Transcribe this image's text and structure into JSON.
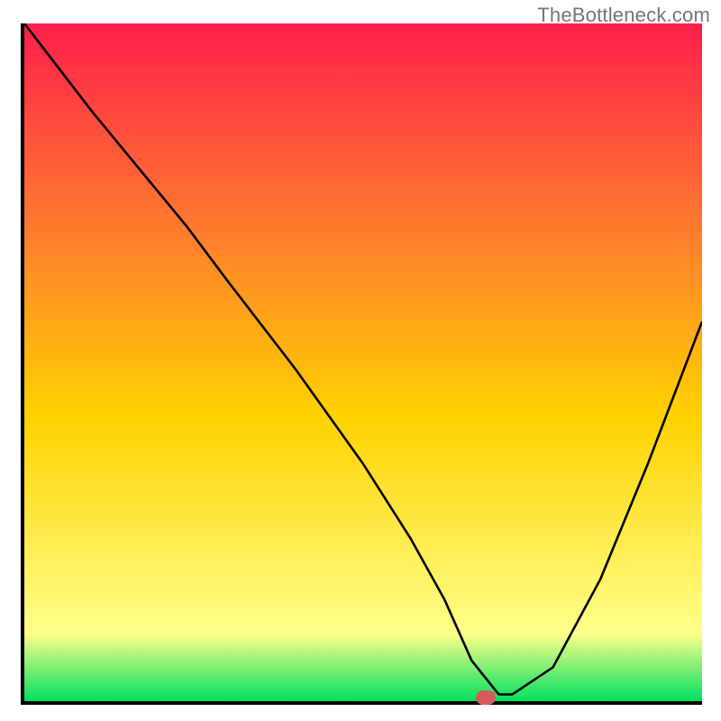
{
  "attribution": "TheBottleneck.com",
  "chart_data": {
    "type": "line",
    "title": "",
    "xlabel": "",
    "ylabel": "",
    "xlim": [
      0,
      100
    ],
    "ylim": [
      0,
      100
    ],
    "series": [
      {
        "name": "curve",
        "x": [
          0,
          10,
          24,
          30,
          40,
          50,
          57,
          62,
          66,
          70,
          72,
          78,
          85,
          92,
          100
        ],
        "values": [
          100,
          87,
          70,
          62,
          49,
          35,
          24,
          15,
          6,
          1,
          1,
          5,
          18,
          35,
          56
        ]
      }
    ],
    "marker": {
      "x": 70,
      "y": 0.7
    },
    "background_gradient": {
      "top": "#ff1f4b",
      "mid_high": "#ff7a2f",
      "mid": "#ffd200",
      "low": "#ffff8a",
      "bottom": "#00e060"
    }
  }
}
